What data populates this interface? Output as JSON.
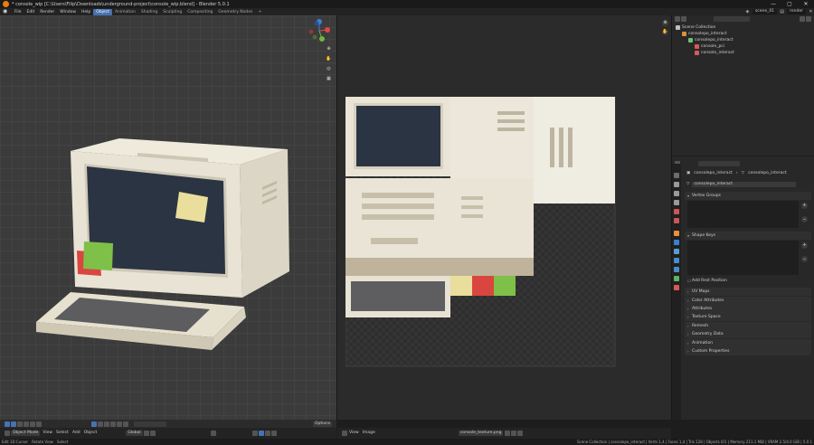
{
  "window": {
    "title": "* console_wip [C:\\Users\\Filip\\Downloads\\underground-project\\console_wip.blend] - Blender 5.0.1",
    "controls": [
      "—",
      "▢",
      "✕"
    ]
  },
  "menubar": {
    "menus": [
      "File",
      "Edit",
      "Render",
      "Window",
      "Help"
    ],
    "workspaces": [
      "Object",
      "Animation",
      "Shading",
      "Sculpting",
      "Compositing",
      "Geometry Nodes",
      "+"
    ],
    "active_workspace": "Object",
    "scene": "scene_01",
    "view_layer": "render"
  },
  "viewport": {
    "header_mode": "Object Mode",
    "menus": [
      "View",
      "Select",
      "Add",
      "Object"
    ],
    "transform_orientation": "Global",
    "options_label": "Options",
    "gizmo_axes": [
      "X",
      "Y",
      "Z"
    ]
  },
  "image_editor": {
    "menus": [
      "View",
      "Image"
    ],
    "image_name": "console_texture.png"
  },
  "outliner": {
    "search_placeholder": "",
    "rows": [
      {
        "label": "Scene Collection",
        "level": 0,
        "color": "#bfbfbf"
      },
      {
        "label": "consolepo_interact",
        "level": 1,
        "color": "#e08f3a"
      },
      {
        "label": "consolepo_interact",
        "level": 2,
        "color": "#6fbf73"
      },
      {
        "label": "console_pci",
        "level": 3,
        "color": "#d85a5a"
      },
      {
        "label": "console_interact",
        "level": 3,
        "color": "#d85a5a"
      }
    ]
  },
  "properties": {
    "search_placeholder": "",
    "breadcrumb": [
      "consolepo_interact",
      "consolepo_interact"
    ],
    "data_name": "consolepo_interact",
    "panels": [
      "Vertex Groups",
      "Shape Keys",
      "Add Rest Position",
      "UV Maps",
      "Color Attributes",
      "Attributes",
      "Texture Space",
      "Remesh",
      "Geometry Data",
      "Animation",
      "Custom Properties"
    ]
  },
  "statusbar": {
    "left": [
      "Edit 3D Cursor",
      "Rotate View",
      "Select"
    ],
    "right": "Scene Collection | consolepo_interact | Verts 1,4 | Faces 1,4 | Tris 128 | Objects 0/1 | Memory 211.1 MiB | VRAM 2.5/4.0 GiB | 5.0.1"
  },
  "colors": {
    "accent": "#4772b3",
    "monitor_screen": "#2b3442",
    "monitor_body": "#e8e3d4",
    "sticky_yellow": "#e9de9c",
    "sticky_green": "#7fc048",
    "sticky_red": "#d9463f"
  }
}
